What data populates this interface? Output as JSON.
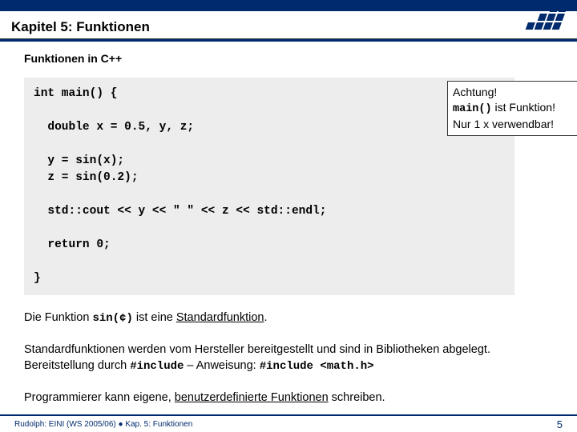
{
  "header": {
    "title": "Kapitel 5: Funktionen"
  },
  "subtitle": "Funktionen in C++",
  "code": {
    "l1": "int main() {",
    "l2": "  double x = 0.5, y, z;",
    "l3": "  y = sin(x);",
    "l4": "  z = sin(0.2);",
    "l5": "  std::cout << y << \" \" << z << std::endl;",
    "l6": "  return 0;",
    "l7": "}"
  },
  "warn": {
    "l1": "Achtung!",
    "l2a": "main()",
    "l2b": " ist Funktion!",
    "l3": "Nur 1 x verwendbar!"
  },
  "para1": {
    "a": "Die Funktion ",
    "b": "sin(¢)",
    "c": " ist eine ",
    "d": "Standardfunktion",
    "e": "."
  },
  "para2": {
    "a": "Standardfunktionen werden vom Hersteller bereitgestellt und sind in Bibliotheken abgelegt. Bereitstellung durch ",
    "b": "#include",
    "c": " – Anweisung: ",
    "d": "#include <math.h>"
  },
  "para3": {
    "a": "Programmierer kann eigene, ",
    "b": "benutzerdefinierte Funktionen",
    "c": " schreiben."
  },
  "footer": {
    "left": "Rudolph: EINI (WS 2005/06)  ●  Kap. 5: Funktionen",
    "page": "5"
  }
}
